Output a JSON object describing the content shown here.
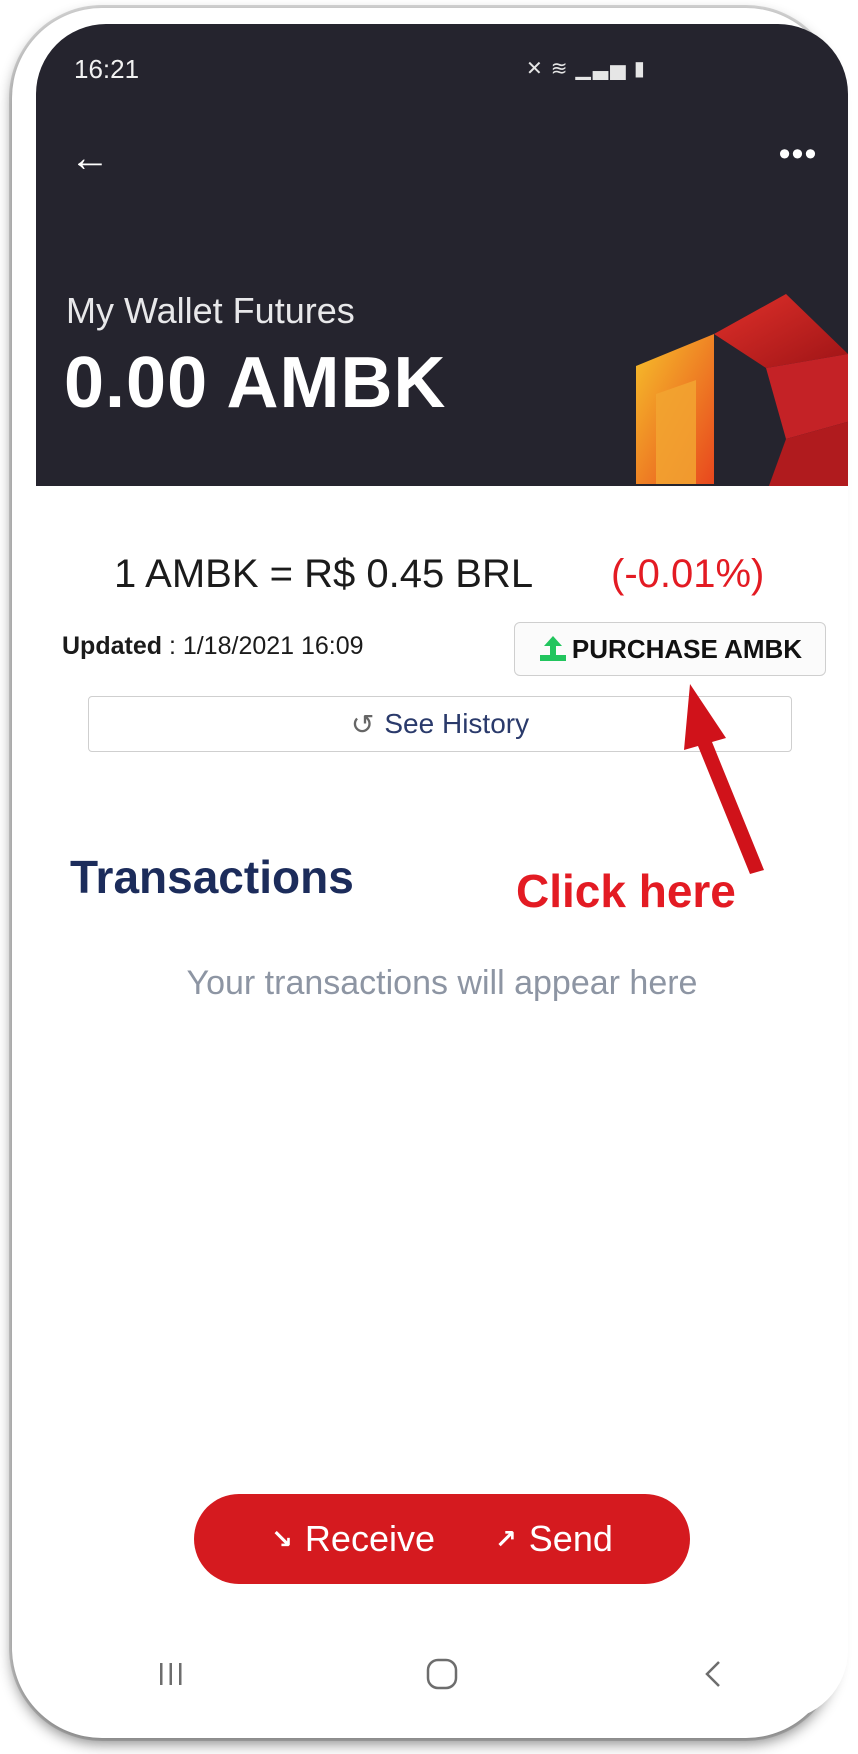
{
  "status_bar": {
    "time": "16:21",
    "icons": [
      "mute-icon",
      "wifi-icon",
      "signal-icon",
      "battery-icon"
    ]
  },
  "header": {
    "back_icon": "back-arrow-icon",
    "more_icon": "more-options-icon",
    "title": "My Wallet Futures",
    "balance": "0.00 AMBK",
    "background_color": "#25242e"
  },
  "rate": {
    "text": "1 AMBK = R$ 0.45  BRL",
    "change": "(-0.01%)",
    "change_color": "#e31b23"
  },
  "updated": {
    "label": "Updated",
    "value": " : 1/18/2021 16:09"
  },
  "purchase_button": {
    "label": "PURCHASE AMBK",
    "icon": "upload-icon",
    "icon_color": "#22c55e"
  },
  "history_button": {
    "label": "See History",
    "icon": "history-icon"
  },
  "annotation": {
    "text": "Click here",
    "color": "#e31b23"
  },
  "transactions": {
    "title": "Transactions",
    "empty_text": "Your transactions will appear here"
  },
  "actions": {
    "receive_label": "Receive",
    "send_label": "Send",
    "bar_color": "#d51a1f"
  },
  "nav": {
    "items": [
      "recent-apps-icon",
      "home-icon",
      "back-icon"
    ]
  }
}
